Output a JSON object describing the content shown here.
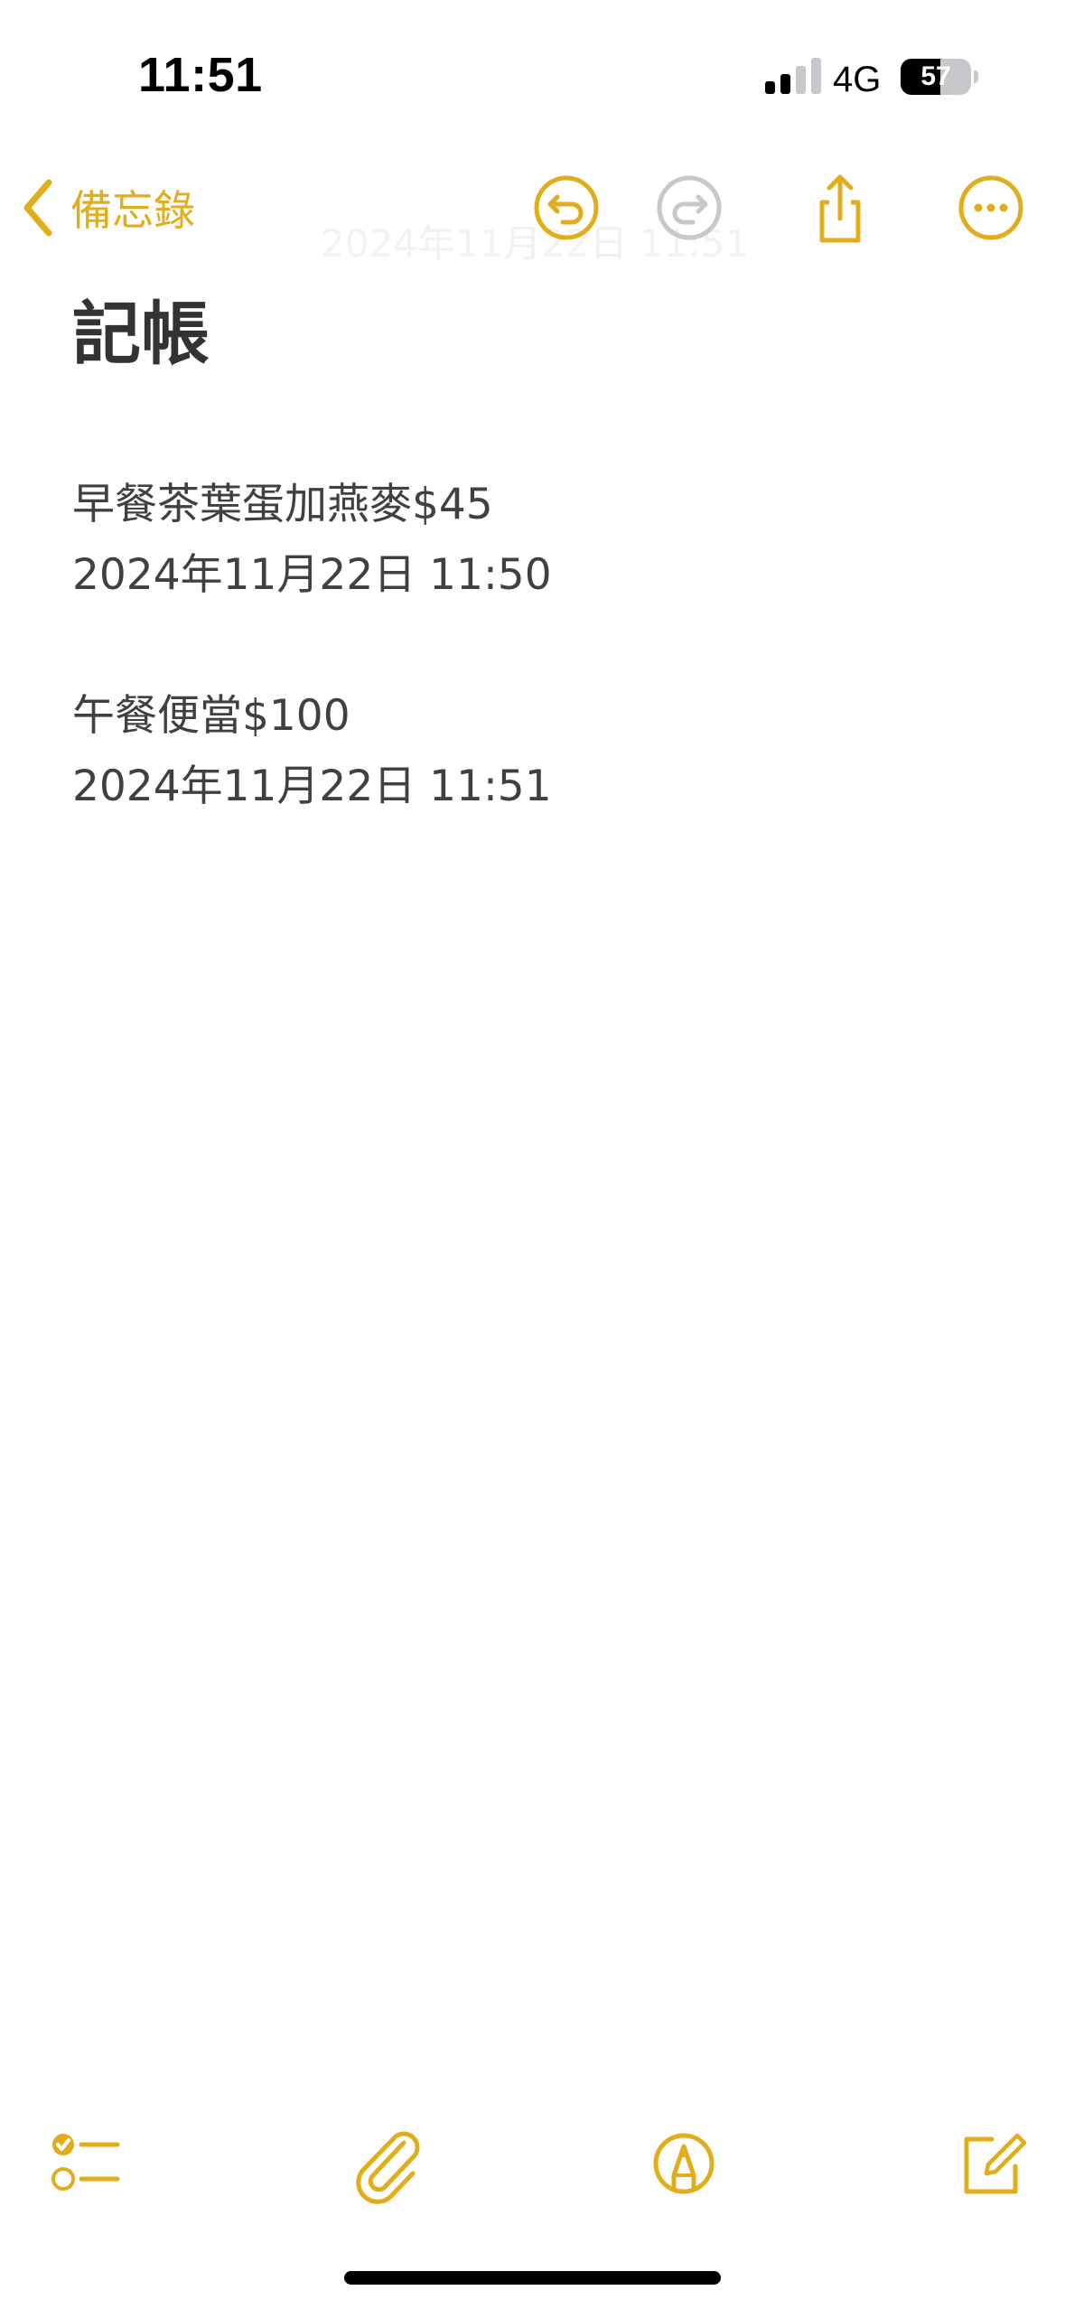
{
  "status_bar": {
    "time": "11:51",
    "network": "4G",
    "battery_level": "57",
    "battery_fraction": 0.57
  },
  "nav": {
    "back_label": "備忘錄",
    "faded_date": "2024年11月22日 11:51",
    "icons": [
      "chevron-left-icon",
      "undo-icon",
      "redo-icon",
      "share-icon",
      "more-icon"
    ]
  },
  "note": {
    "title": "記帳",
    "entries": [
      {
        "item": "早餐茶葉蛋加燕麥$45",
        "timestamp": "2024年11月22日 11:50"
      },
      {
        "item": "午餐便當$100",
        "timestamp": "2024年11月22日 11:51"
      }
    ]
  },
  "toolbar": {
    "icons": [
      "checklist-icon",
      "paperclip-icon",
      "markup-icon",
      "compose-icon"
    ]
  },
  "colors": {
    "accent": "#e1ad1a",
    "disabled": "#c7c7cc",
    "text": "#404042",
    "title": "#333335"
  }
}
